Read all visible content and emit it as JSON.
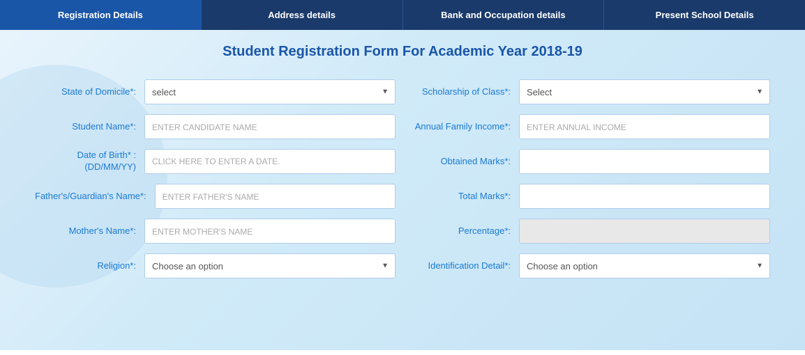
{
  "tabs": [
    {
      "id": "registration",
      "label": "Registration Details",
      "active": true
    },
    {
      "id": "address",
      "label": "Address details",
      "active": false
    },
    {
      "id": "bank",
      "label": "Bank and Occupation details",
      "active": false
    },
    {
      "id": "school",
      "label": "Present School Details",
      "active": false
    }
  ],
  "form": {
    "title": "Student Registration Form For Academic Year 2018-19",
    "left": {
      "fields": [
        {
          "label": "State of Domicile*:",
          "type": "select",
          "name": "state-of-domicile",
          "value": "select",
          "options": [
            "select"
          ]
        },
        {
          "label": "Student Name*:",
          "type": "text",
          "name": "student-name",
          "placeholder": "ENTER CANDIDATE NAME"
        },
        {
          "label": "Date of Birth* :\n(DD/MM/YY)",
          "type": "text",
          "name": "date-of-birth",
          "placeholder": "CLICK HERE TO ENTER A DATE.",
          "isDate": true
        },
        {
          "label": "Father's/Guardian's Name*:",
          "type": "text",
          "name": "father-name",
          "placeholder": "ENTER FATHER'S NAME"
        },
        {
          "label": "Mother's Name*:",
          "type": "text",
          "name": "mother-name",
          "placeholder": "ENTER MOTHER'S NAME"
        },
        {
          "label": "Religion*:",
          "type": "select",
          "name": "religion",
          "value": "Choose an option",
          "options": [
            "Choose an option"
          ]
        }
      ]
    },
    "right": {
      "fields": [
        {
          "label": "Scholarship of Class*:",
          "type": "select",
          "name": "scholarship-class",
          "value": "Select",
          "options": [
            "Select"
          ]
        },
        {
          "label": "Annual Family Income*:",
          "type": "text",
          "name": "annual-income",
          "placeholder": "ENTER ANNUAL INCOME"
        },
        {
          "label": "Obtained Marks*:",
          "type": "text",
          "name": "obtained-marks",
          "placeholder": ""
        },
        {
          "label": "Total Marks*:",
          "type": "text",
          "name": "total-marks",
          "placeholder": ""
        },
        {
          "label": "Percentage*:",
          "type": "text",
          "name": "percentage",
          "placeholder": "",
          "disabled": true
        },
        {
          "label": "Identification Detail*:",
          "type": "select",
          "name": "identification-detail",
          "value": "Choose an option",
          "options": [
            "Choose an option"
          ]
        }
      ]
    }
  }
}
